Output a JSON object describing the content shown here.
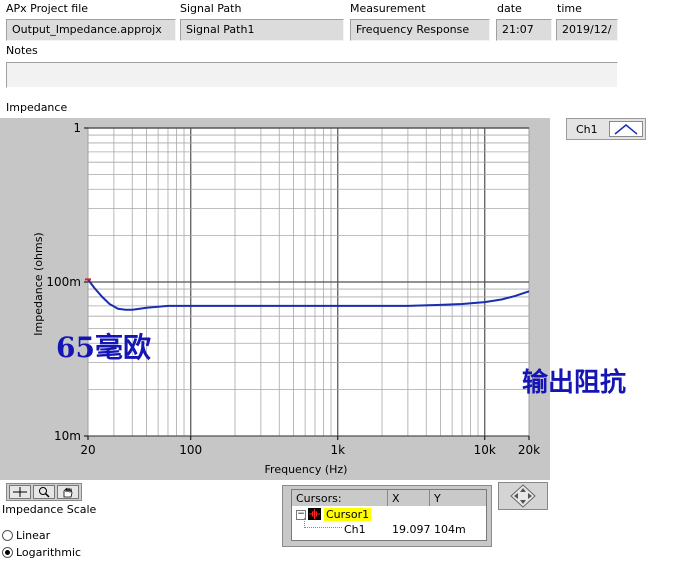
{
  "header": {
    "project_label": "APx Project file",
    "project_value": "Output_Impedance.approjx",
    "signal_label": "Signal Path",
    "signal_value": "Signal Path1",
    "measurement_label": "Measurement",
    "measurement_value": "Frequency Response",
    "date_label": "date",
    "date_value": "21:07",
    "time_label": "time",
    "time_value": "2019/12/"
  },
  "notes": {
    "label": "Notes",
    "value": ""
  },
  "graph": {
    "label": "Impedance"
  },
  "legend": {
    "channel": "Ch1",
    "color": "#1a2db0"
  },
  "annotations": {
    "left": "65毫欧",
    "right": "输出阻抗"
  },
  "scale": {
    "label": "Impedance Scale",
    "options": [
      "Linear",
      "Logarithmic"
    ],
    "selected": "Logarithmic"
  },
  "cursors": {
    "header": [
      "Cursors:",
      "X",
      "Y"
    ],
    "cursor_name": "Cursor1",
    "channel": "Ch1",
    "x": "19.097",
    "y": "104m"
  },
  "chart_data": {
    "type": "line",
    "title": "",
    "xlabel": "Frequency (Hz)",
    "ylabel": "Impedance (ohms)",
    "xscale": "log",
    "yscale": "log",
    "xlim": [
      20,
      20000
    ],
    "ylim": [
      0.01,
      1
    ],
    "x_ticks": [
      20,
      100,
      1000,
      10000,
      20000
    ],
    "x_tick_labels": [
      "20",
      "100",
      "1k",
      "10k",
      "20k"
    ],
    "y_ticks": [
      0.01,
      0.1,
      1
    ],
    "y_tick_labels": [
      "10m",
      "100m",
      "1"
    ],
    "grid": true,
    "series": [
      {
        "name": "Ch1",
        "color": "#1a2db0",
        "x": [
          20,
          22,
          25,
          28,
          32,
          36,
          40,
          45,
          50,
          60,
          70,
          80,
          100,
          150,
          200,
          300,
          500,
          700,
          1000,
          1500,
          2000,
          3000,
          5000,
          7000,
          10000,
          13000,
          16000,
          20000
        ],
        "y": [
          0.104,
          0.092,
          0.08,
          0.072,
          0.067,
          0.066,
          0.066,
          0.067,
          0.068,
          0.069,
          0.07,
          0.07,
          0.07,
          0.07,
          0.07,
          0.07,
          0.07,
          0.07,
          0.07,
          0.07,
          0.07,
          0.07,
          0.071,
          0.072,
          0.074,
          0.077,
          0.081,
          0.087
        ]
      }
    ]
  }
}
